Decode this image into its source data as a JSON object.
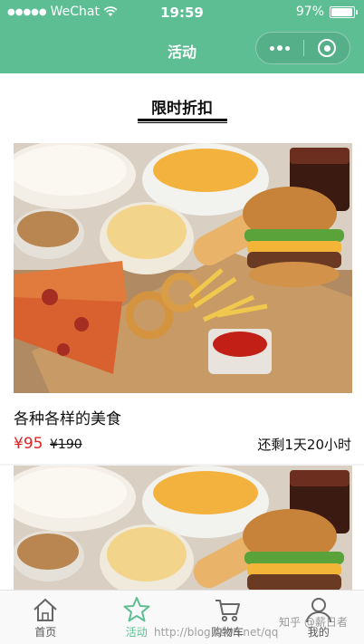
{
  "status_bar": {
    "carrier": "WeChat",
    "time": "19:59",
    "battery": "97%",
    "battery_level": 0.97
  },
  "nav": {
    "title": "活动"
  },
  "section": {
    "title": "限时折扣"
  },
  "products": [
    {
      "name": "各种各样的美食",
      "price": "¥95",
      "original_price": "¥190",
      "remaining": "还剩1天20小时"
    },
    {
      "name": "",
      "price": "",
      "original_price": "",
      "remaining": ""
    }
  ],
  "tabbar": {
    "items": [
      {
        "label": "首页",
        "icon": "home-icon",
        "active": false
      },
      {
        "label": "活动",
        "icon": "star-icon",
        "active": true
      },
      {
        "label": "购物车",
        "icon": "cart-icon",
        "active": false
      },
      {
        "label": "我的",
        "icon": "user-icon",
        "active": false
      }
    ],
    "active_color": "#5dbe94"
  },
  "watermarks": {
    "blog": "http://blog.csdn.net/qq",
    "zhihu": "知乎 @薪日者"
  },
  "colors": {
    "accent": "#5dbe94",
    "price": "#e02424"
  }
}
